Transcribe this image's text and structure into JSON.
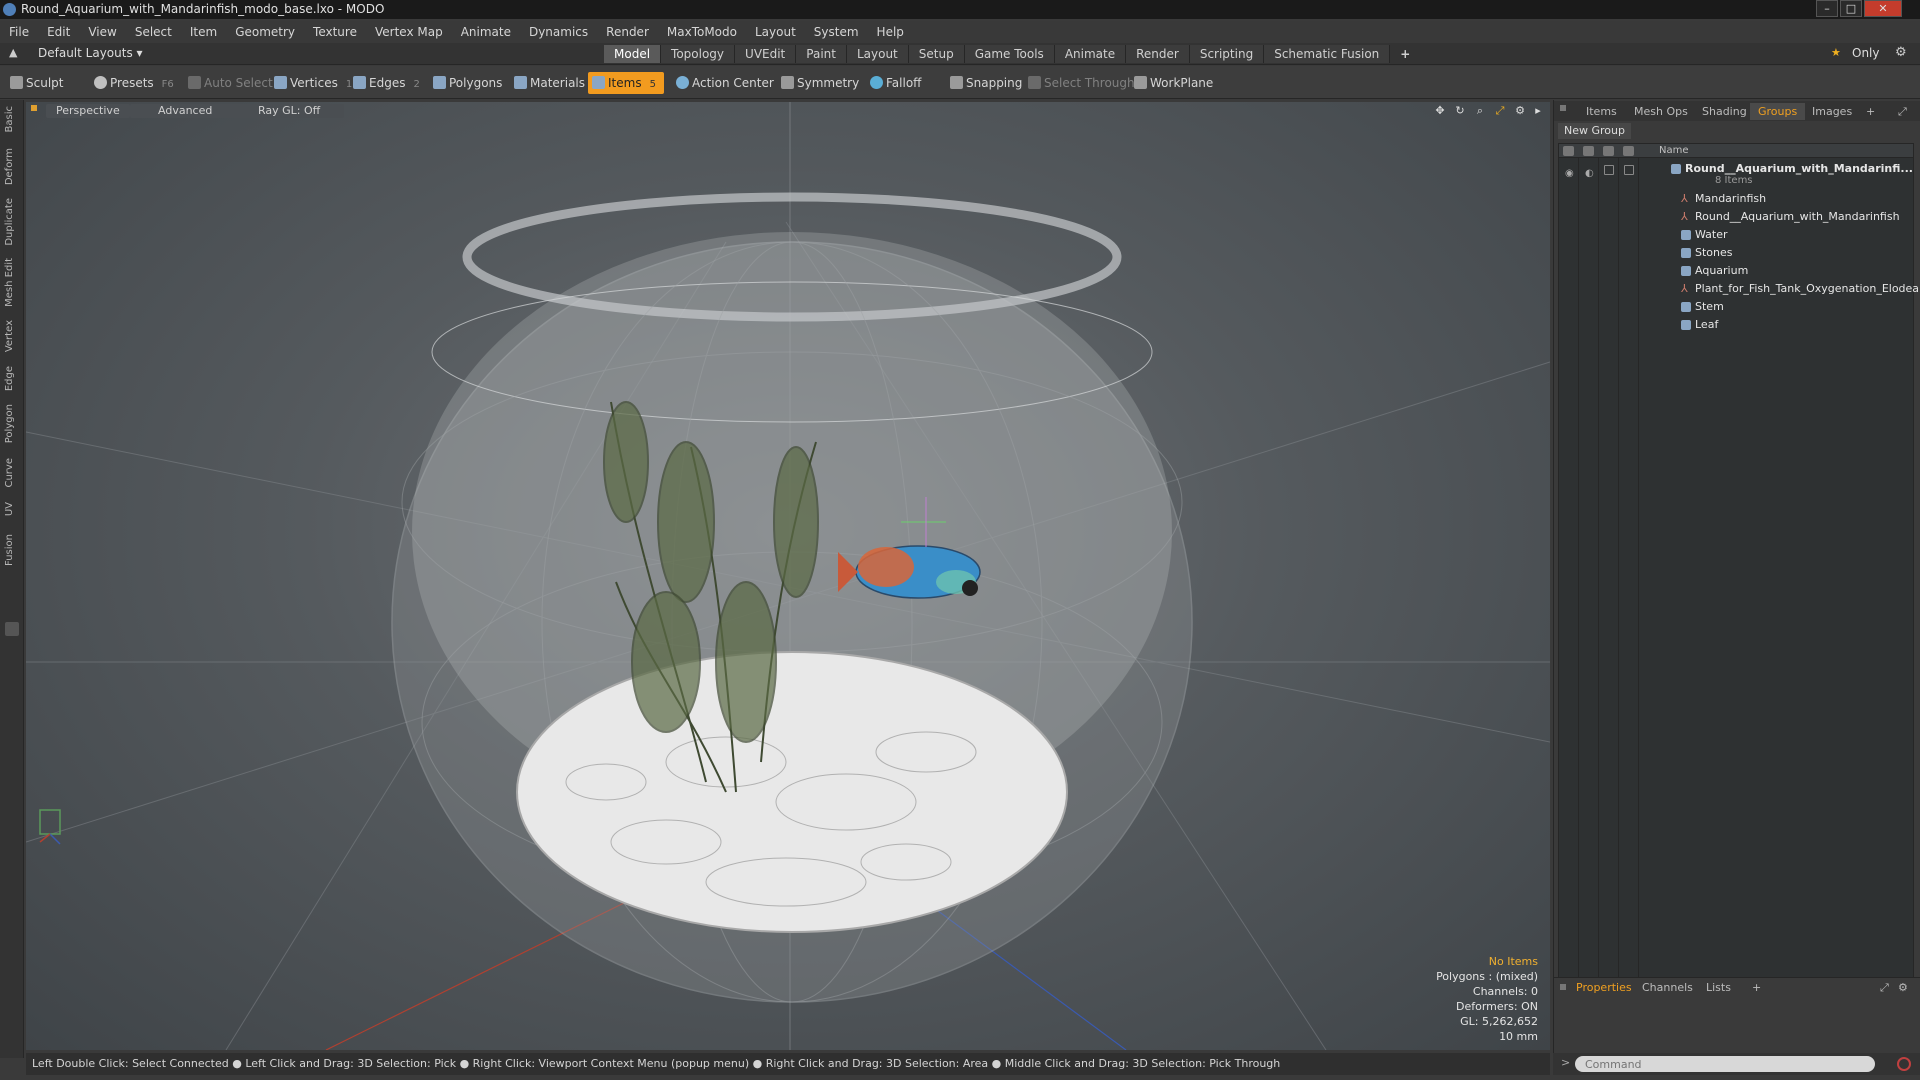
{
  "window": {
    "title": "Round_Aquarium_with_Mandarinfish_modo_base.lxo - MODO",
    "close": "✕",
    "minimize": "–",
    "maximize": "□"
  },
  "menu": [
    "File",
    "Edit",
    "View",
    "Select",
    "Item",
    "Geometry",
    "Texture",
    "Vertex Map",
    "Animate",
    "Dynamics",
    "Render",
    "MaxToModo",
    "Layout",
    "System",
    "Help"
  ],
  "layout": {
    "selector": "Default Layouts ▾",
    "only_label": "Only",
    "star": "★",
    "tabs": [
      "Model",
      "Topology",
      "UVEdit",
      "Paint",
      "Layout",
      "Setup",
      "Game Tools",
      "Animate",
      "Render",
      "Scripting",
      "Schematic Fusion"
    ],
    "plus": "+"
  },
  "toolbar": {
    "sculpt": "Sculpt",
    "presets": "Presets",
    "presets_key": "F6",
    "auto_select": "Auto Select",
    "vertices": "Vertices",
    "vertices_key": "1",
    "edges": "Edges",
    "edges_key": "2",
    "polygons": "Polygons",
    "materials": "Materials",
    "items": "Items",
    "items_key": "5",
    "action_center": "Action Center",
    "symmetry": "Symmetry",
    "falloff": "Falloff",
    "snapping": "Snapping",
    "select_through": "Select Through",
    "workplane": "WorkPlane"
  },
  "left_tabs": [
    "Basic",
    "Deform",
    "Duplicate",
    "Mesh Edit",
    "Vertex",
    "Edge",
    "Polygon",
    "Curve",
    "UV",
    "Fusion"
  ],
  "viewport": {
    "perspective": "Perspective",
    "advanced": "Advanced",
    "raygl": "Ray GL: Off",
    "info": {
      "items": "No Items",
      "polygons": "Polygons : (mixed)",
      "channels": "Channels: 0",
      "deformers": "Deformers: ON",
      "gl": "GL: 5,262,652",
      "scale": "10 mm"
    }
  },
  "statusbar": "Left Double Click: Select Connected ● Left Click and Drag: 3D Selection: Pick ● Right Click: Viewport Context Menu (popup menu) ● Right Click and Drag: 3D Selection: Area ● Middle Click and Drag: 3D Selection: Pick Through",
  "panel": {
    "tabs": [
      "Items",
      "Mesh Ops",
      "Shading",
      "Groups",
      "Images"
    ],
    "plus": "+",
    "new_group": "New Group",
    "name_header": "Name",
    "group": {
      "name": "Round__Aquarium_with_Mandarinfi...",
      "count": "8 Items"
    },
    "items": [
      {
        "label": "Mandarinfish",
        "type": "locator"
      },
      {
        "label": "Round__Aquarium_with_Mandarinfish",
        "type": "locator"
      },
      {
        "label": "Water",
        "type": "mesh"
      },
      {
        "label": "Stones",
        "type": "mesh"
      },
      {
        "label": "Aquarium",
        "type": "mesh"
      },
      {
        "label": "Plant_for_Fish_Tank_Oxygenation_Elodea",
        "type": "locator"
      },
      {
        "label": "Stem",
        "type": "mesh"
      },
      {
        "label": "Leaf",
        "type": "mesh"
      }
    ]
  },
  "properties": {
    "tabs": [
      "Properties",
      "Channels",
      "Lists"
    ],
    "plus": "+"
  },
  "command": {
    "placeholder": "Command",
    "arrow": ">"
  },
  "colors": {
    "accent": "#f29b1f",
    "active_tab": "#f0a020"
  }
}
